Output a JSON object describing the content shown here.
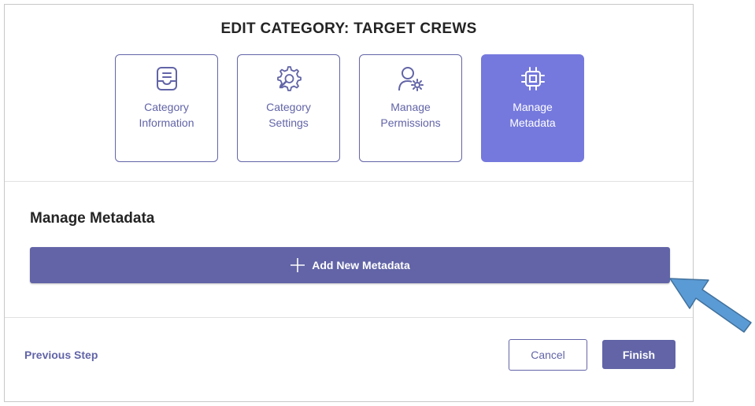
{
  "dialog": {
    "title": "EDIT CATEGORY: TARGET CREWS"
  },
  "steps": [
    {
      "line1": "Category",
      "line2": "Information",
      "icon": "inbox-icon",
      "active": false
    },
    {
      "line1": "Category",
      "line2": "Settings",
      "icon": "gear-icon",
      "active": false
    },
    {
      "line1": "Manage",
      "line2": "Permissions",
      "icon": "person-gear-icon",
      "active": false
    },
    {
      "line1": "Manage",
      "line2": "Metadata",
      "icon": "chip-icon",
      "active": true
    }
  ],
  "section": {
    "title": "Manage Metadata"
  },
  "add_button": {
    "label": "Add New Metadata",
    "icon": "plus-icon"
  },
  "footer": {
    "previous_label": "Previous Step",
    "cancel_label": "Cancel",
    "finish_label": "Finish"
  },
  "annotation": {
    "icon": "pointer-arrow-icon",
    "color": "#5b9bd5"
  },
  "colors": {
    "brand": "#6264a7",
    "active_step": "#7579dd",
    "text": "#242424",
    "divider": "#e1e1e1"
  }
}
